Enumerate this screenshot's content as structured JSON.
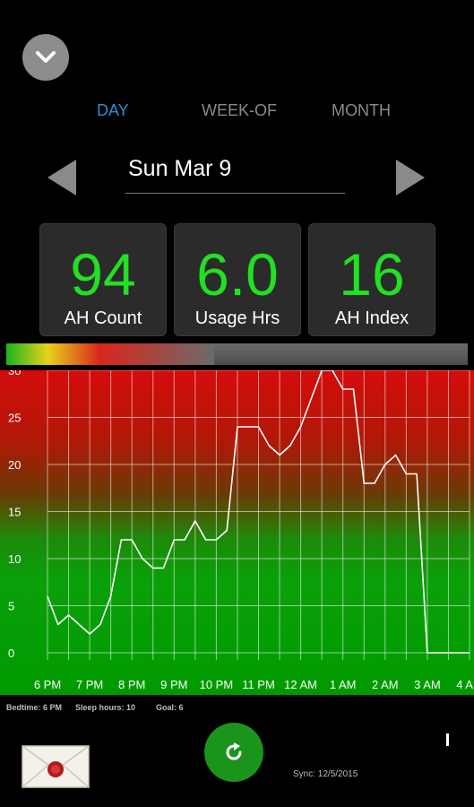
{
  "header": {
    "collapse_icon": "chevron-down-icon"
  },
  "tabs": [
    {
      "label": "DAY",
      "active": true
    },
    {
      "label": "WEEK-OF",
      "active": false
    },
    {
      "label": "MONTH",
      "active": false
    }
  ],
  "date_nav": {
    "current_date": "Sun Mar 9",
    "prev_icon": "left-arrow-icon",
    "next_icon": "right-arrow-icon"
  },
  "stats": [
    {
      "value": "94",
      "label": "AH Count"
    },
    {
      "value": "6.0",
      "label": "Usage Hrs"
    },
    {
      "value": "16",
      "label": "AH Index"
    }
  ],
  "progress": {
    "fraction": 0.45
  },
  "colors": {
    "accent": "#2a8fd6",
    "stat_green": "#22e022",
    "chart_red": "#d40c0c",
    "chart_green": "#0aa00a",
    "sync_green": "#1a941a"
  },
  "chart_data": {
    "type": "line",
    "x": [
      "6 PM",
      "6:15 PM",
      "6:30 PM",
      "6:45 PM",
      "7 PM",
      "7:15 PM",
      "7:30 PM",
      "7:45 PM",
      "8 PM",
      "8:15 PM",
      "8:30 PM",
      "8:45 PM",
      "9 PM",
      "9:15 PM",
      "9:30 PM",
      "9:45 PM",
      "10 PM",
      "10:15 PM",
      "10:30 PM",
      "10:45 PM",
      "11 PM",
      "11:15 PM",
      "11:30 PM",
      "11:45 PM",
      "12 AM",
      "12:15 AM",
      "12:30 AM",
      "12:45 AM",
      "1 AM",
      "1:15 AM",
      "1:30 AM",
      "1:45 AM",
      "2 AM",
      "2:15 AM",
      "2:30 AM",
      "2:45 AM",
      "3 AM",
      "3:15 AM",
      "3:30 AM",
      "3:45 AM",
      "4 AM"
    ],
    "y_points": [
      {
        "x": 0,
        "y": 6
      },
      {
        "x": 0.25,
        "y": 3
      },
      {
        "x": 0.5,
        "y": 4
      },
      {
        "x": 0.75,
        "y": 3
      },
      {
        "x": 1.0,
        "y": 2
      },
      {
        "x": 1.25,
        "y": 3
      },
      {
        "x": 1.5,
        "y": 6
      },
      {
        "x": 1.75,
        "y": 12
      },
      {
        "x": 2.0,
        "y": 12
      },
      {
        "x": 2.25,
        "y": 10
      },
      {
        "x": 2.5,
        "y": 9
      },
      {
        "x": 2.75,
        "y": 9
      },
      {
        "x": 3.0,
        "y": 12
      },
      {
        "x": 3.25,
        "y": 12
      },
      {
        "x": 3.5,
        "y": 14
      },
      {
        "x": 3.75,
        "y": 12
      },
      {
        "x": 4.0,
        "y": 12
      },
      {
        "x": 4.25,
        "y": 13
      },
      {
        "x": 4.5,
        "y": 24
      },
      {
        "x": 4.75,
        "y": 24
      },
      {
        "x": 5.0,
        "y": 24
      },
      {
        "x": 5.25,
        "y": 22
      },
      {
        "x": 5.5,
        "y": 21
      },
      {
        "x": 5.75,
        "y": 22
      },
      {
        "x": 6.0,
        "y": 24
      },
      {
        "x": 6.25,
        "y": 27
      },
      {
        "x": 6.5,
        "y": 30
      },
      {
        "x": 6.75,
        "y": 30
      },
      {
        "x": 7.0,
        "y": 28
      },
      {
        "x": 7.25,
        "y": 28
      },
      {
        "x": 7.5,
        "y": 18
      },
      {
        "x": 7.75,
        "y": 18
      },
      {
        "x": 8.0,
        "y": 20
      },
      {
        "x": 8.25,
        "y": 21
      },
      {
        "x": 8.5,
        "y": 19
      },
      {
        "x": 8.75,
        "y": 19
      },
      {
        "x": 9.0,
        "y": 0
      },
      {
        "x": 10.0,
        "y": 0
      }
    ],
    "x_ticks": [
      "6 PM",
      "7 PM",
      "8 PM",
      "9 PM",
      "10 PM",
      "11 PM",
      "12 AM",
      "1 AM",
      "2 AM",
      "3 AM",
      "4 AM"
    ],
    "y_ticks": [
      0,
      5,
      10,
      15,
      20,
      25,
      30
    ],
    "ylim": [
      0,
      30
    ],
    "xlim": [
      0,
      10
    ],
    "grid": true,
    "title": "",
    "xlabel": "",
    "ylabel": "",
    "line_color": "#ffffff"
  },
  "footer": {
    "bedtime": "Bedtime: 6 PM",
    "sleep_hours": "Sleep hours: 10",
    "goal": "Goal: 6",
    "sync": "Sync: 12/5/2015",
    "sync_icon": "refresh-icon",
    "email_icon": "envelope-icon"
  }
}
